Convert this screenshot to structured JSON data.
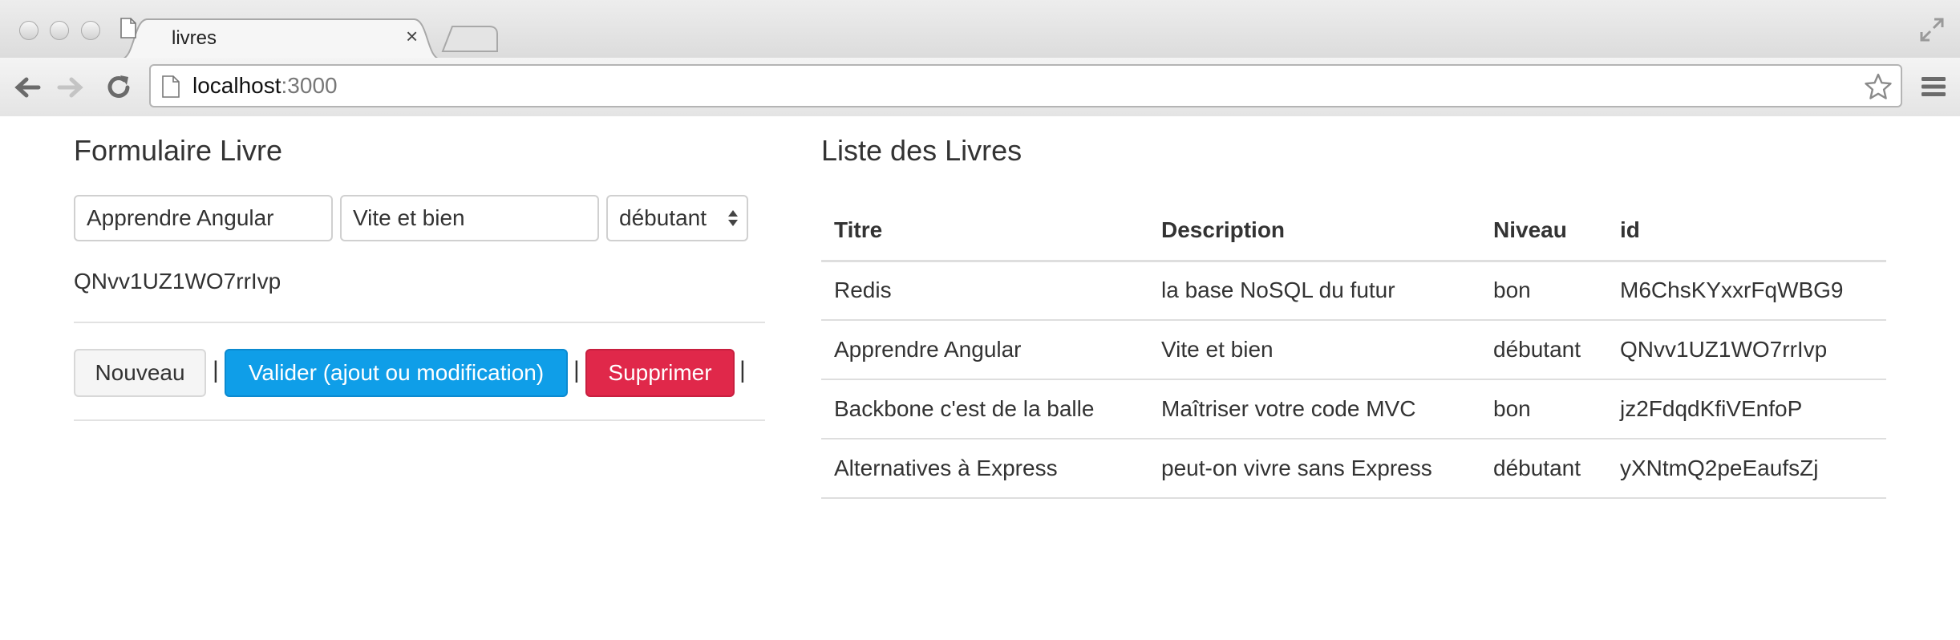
{
  "browser": {
    "tab_title": "livres",
    "tab_close": "×",
    "url_host": "localhost",
    "url_port": ":3000"
  },
  "form": {
    "heading": "Formulaire Livre",
    "title_value": "Apprendre Angular",
    "description_value": "Vite et bien",
    "level_value": "débutant",
    "record_id": "QNvv1UZ1WO7rrIvp",
    "new_label": "Nouveau",
    "save_label": "Valider (ajout ou modification)",
    "delete_label": "Supprimer",
    "separator": "|"
  },
  "list": {
    "heading": "Liste des Livres",
    "columns": [
      "Titre",
      "Description",
      "Niveau",
      "id"
    ],
    "rows": [
      [
        "Redis",
        "la base NoSQL du futur",
        "bon",
        "M6ChsKYxxrFqWBG9"
      ],
      [
        "Apprendre Angular",
        "Vite et bien",
        "débutant",
        "QNvv1UZ1WO7rrIvp"
      ],
      [
        "Backbone c'est de la balle",
        "Maîtriser votre code MVC",
        "bon",
        "jz2FdqdKfiVEnfoP"
      ],
      [
        "Alternatives à Express",
        "peut-on vivre sans Express",
        "débutant",
        "yXNtmQ2peEaufsZj"
      ]
    ]
  },
  "colors": {
    "primary": "#0f9ee8",
    "danger": "#e0284a",
    "default_bg": "#f5f5f5"
  },
  "icons": [
    "page-icon",
    "close-icon",
    "fullscreen-icon",
    "back-arrow-icon",
    "forward-arrow-icon",
    "reload-icon",
    "star-icon",
    "menu-icon",
    "select-arrows-icon"
  ]
}
